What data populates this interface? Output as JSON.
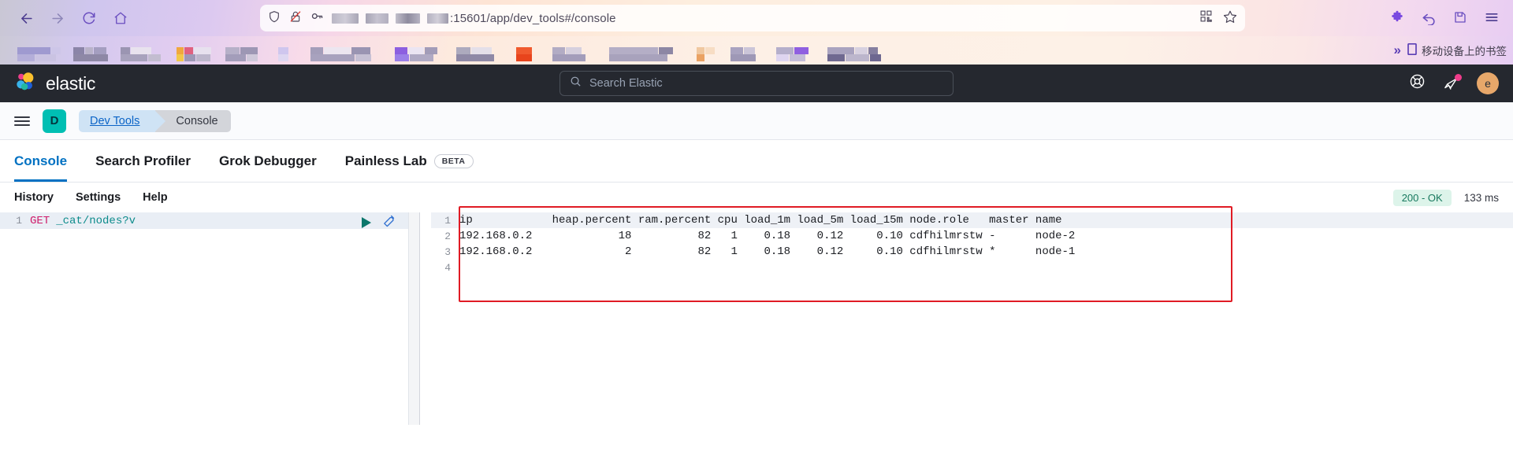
{
  "browser": {
    "nav": {
      "back": "back-arrow",
      "forward": "forward-arrow",
      "reload": "reload",
      "home": "home"
    },
    "url": {
      "visible_suffix": ":15601/app/dev_tools#/console",
      "host_redacted": true,
      "shield_icon": "tracking-protection-shield",
      "permission_icon": "blocked-autoplay",
      "key_icon": "saved-logins-key",
      "qr_icon": "qr-code",
      "bookmark_icon": "star-outline"
    },
    "toolbar_right": {
      "extensions": "puzzle-piece",
      "undo": "undo-arrow",
      "save_to_pocket": "save-page",
      "menu": "hamburger-menu"
    }
  },
  "bookmarks": {
    "redacted": true,
    "overflow_label": "»",
    "mobile_bookmarks": "移动设备上的书签"
  },
  "elastic_header": {
    "brand": "elastic",
    "search_placeholder": "Search Elastic",
    "help_icon": "help-lifebuoy-icon",
    "news_icon": "announcement-megaphone-icon",
    "news_badge": true,
    "avatar_initial": "e",
    "avatar_color": "#e7a76a",
    "background": "#25282f"
  },
  "breadcrumb": {
    "menu_icon": "hamburger-menu-icon",
    "space_initial": "D",
    "space_color": "#00bfb3",
    "items": [
      {
        "label": "Dev Tools",
        "active": false
      },
      {
        "label": "Console",
        "active": true
      }
    ]
  },
  "tabs": {
    "accent": "#0071c2",
    "items": [
      {
        "label": "Console",
        "active": true,
        "badge": null
      },
      {
        "label": "Search Profiler",
        "active": false,
        "badge": null
      },
      {
        "label": "Grok Debugger",
        "active": false,
        "badge": null
      },
      {
        "label": "Painless Lab",
        "active": false,
        "badge": "BETA"
      }
    ]
  },
  "console_toolbar": {
    "items": [
      "History",
      "Settings",
      "Help"
    ],
    "status": "200 - OK",
    "status_color": "#17795e",
    "timing": "133 ms"
  },
  "editor": {
    "lines": [
      {
        "number": "1",
        "method": "GET",
        "path": "_cat/nodes?v"
      }
    ],
    "play_button": "send-request-play-icon",
    "wrench_button": "request-options-wrench-icon"
  },
  "output": {
    "highlight_color": "#e01b24",
    "lines": [
      {
        "number": "1",
        "text": "ip            heap.percent ram.percent cpu load_1m load_5m load_15m node.role   master name"
      },
      {
        "number": "2",
        "text": "192.168.0.2             18          82   1    0.18    0.12     0.10 cdfhilmrstw -      node-2"
      },
      {
        "number": "3",
        "text": "192.168.0.2              2          82   1    0.18    0.12     0.10 cdfhilmrstw *      node-1"
      },
      {
        "number": "4",
        "text": ""
      }
    ],
    "table": {
      "columns": [
        "ip",
        "heap.percent",
        "ram.percent",
        "cpu",
        "load_1m",
        "load_5m",
        "load_15m",
        "node.role",
        "master",
        "name"
      ],
      "rows": [
        [
          "192.168.0.2",
          "18",
          "82",
          "1",
          "0.18",
          "0.12",
          "0.10",
          "cdfhilmrstw",
          "-",
          "node-2"
        ],
        [
          "192.168.0.2",
          "2",
          "82",
          "1",
          "0.18",
          "0.12",
          "0.10",
          "cdfhilmrstw",
          "*",
          "node-1"
        ]
      ]
    }
  }
}
